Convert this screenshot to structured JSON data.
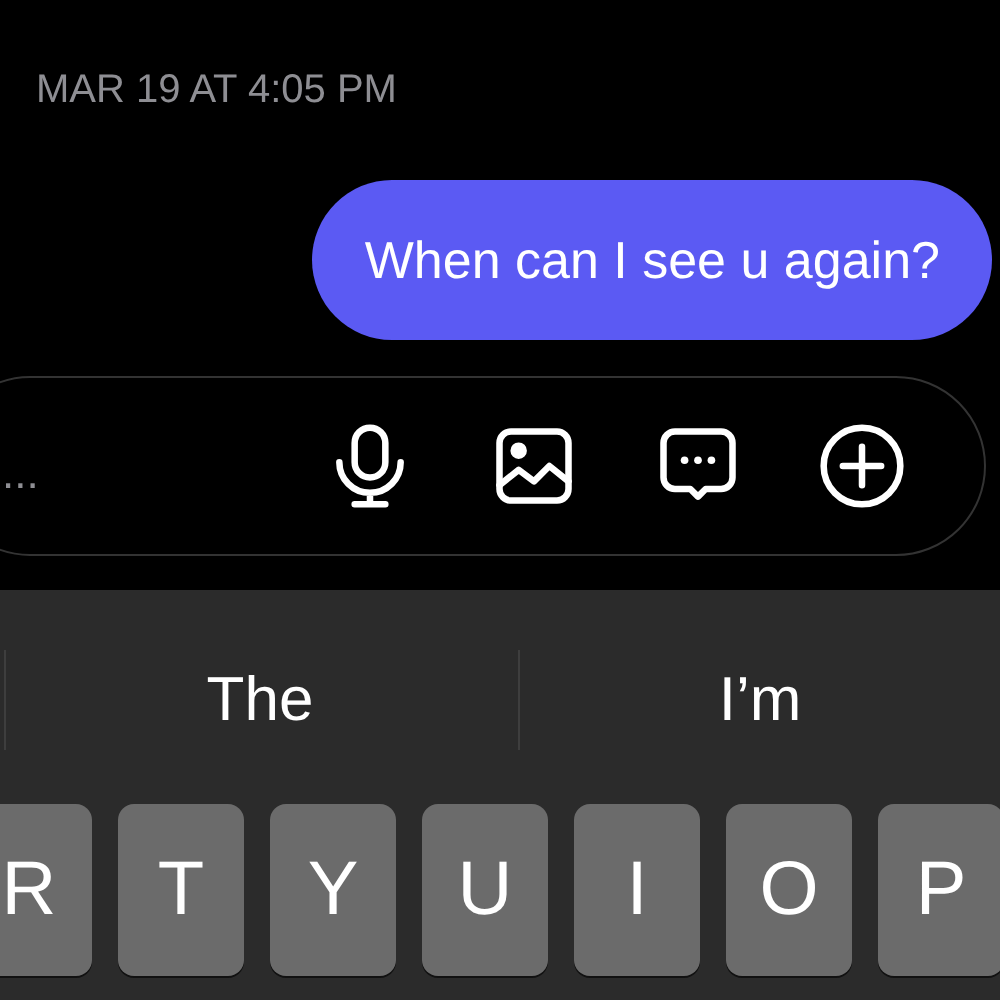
{
  "timestamp": "MAR 19 AT 4:05 PM",
  "messages": [
    {
      "text": "When can I see u again?",
      "kind": "sent"
    }
  ],
  "composer": {
    "placeholder": "...",
    "actions": [
      {
        "kind": "mic"
      },
      {
        "kind": "image"
      },
      {
        "kind": "chat"
      },
      {
        "kind": "plus"
      }
    ]
  },
  "suggestions": [
    "The",
    "I’m"
  ],
  "keys": [
    "R",
    "T",
    "Y",
    "U",
    "I",
    "O",
    "P"
  ]
}
